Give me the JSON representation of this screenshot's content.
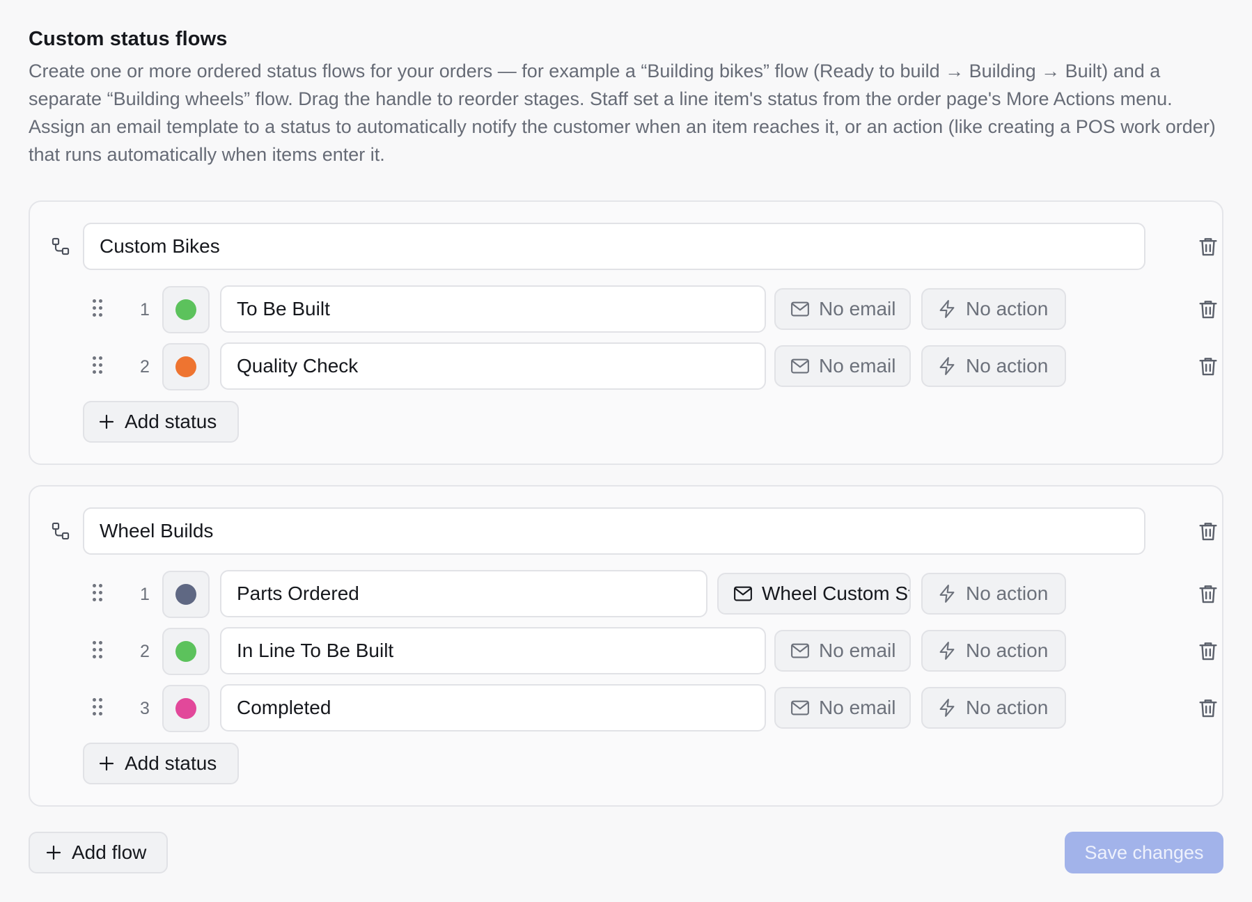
{
  "header": {
    "title": "Custom status flows",
    "description": "Create one or more ordered status flows for your orders — for example a “Building bikes” flow (Ready to build → Building → Built) and a separate “Building wheels” flow. Drag the handle to reorder stages. Staff set a line item's status from the order page's More Actions menu. Assign an email template to a status to automatically notify the customer when an item reaches it, or an action (like creating a POS work order) that runs automatically when items enter it."
  },
  "flows": [
    {
      "name": "Custom Bikes",
      "statuses": [
        {
          "number": "1",
          "name": "To Be Built",
          "color": "#5cc25c",
          "email": "No email",
          "action": "No action"
        },
        {
          "number": "2",
          "name": "Quality Check",
          "color": "#ee7430",
          "email": "No email",
          "action": "No action"
        }
      ],
      "add_status_label": "Add status"
    },
    {
      "name": "Wheel Builds",
      "statuses": [
        {
          "number": "1",
          "name": "Parts Ordered",
          "color": "#5f6883",
          "email": "Wheel Custom Stat...",
          "action": "No action"
        },
        {
          "number": "2",
          "name": "In Line To Be Built",
          "color": "#5cc25c",
          "email": "No email",
          "action": "No action"
        },
        {
          "number": "3",
          "name": "Completed",
          "color": "#e2489a",
          "email": "No email",
          "action": "No action"
        }
      ],
      "add_status_label": "Add status"
    }
  ],
  "footer": {
    "add_flow_label": "Add flow",
    "save_label": "Save changes"
  },
  "icons": {
    "flow": "flow-icon",
    "drag": "drag-handle-icon",
    "email": "envelope-icon",
    "action": "lightning-icon",
    "delete": "trash-icon",
    "add": "plus-icon"
  },
  "colors": {
    "save_disabled": "#a2b3ea"
  }
}
